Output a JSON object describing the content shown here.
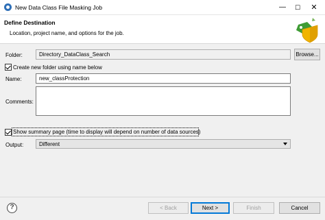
{
  "window": {
    "title": "New Data Class File Masking Job",
    "icon": "masking-app-icon",
    "minimize_glyph": "—",
    "maximize_glyph": "☐",
    "close_glyph": "✕"
  },
  "header": {
    "title": "Define Destination",
    "description": "Location, project name, and options for the job.",
    "art_icon": "tag-shield-icon"
  },
  "form": {
    "folder_label": "Folder:",
    "folder_value": "Directory_DataClass_Search",
    "browse_label": "Browse...",
    "create_folder_label": "Create new folder using name below",
    "create_folder_checked": true,
    "name_label": "Name:",
    "name_value": "new_classProtection",
    "comments_label": "Comments:",
    "comments_value": "",
    "summary_label": "Show summary page (time to display will depend on number of data sources)",
    "summary_checked": true,
    "output_label": "Output:",
    "output_value": "Different"
  },
  "footer": {
    "help_glyph": "?",
    "back_label": "< Back",
    "next_label": "Next >",
    "finish_label": "Finish",
    "cancel_label": "Cancel"
  },
  "colors": {
    "accent": "#0078d7",
    "tag_green": "#3f9c35",
    "shield_yellow": "#f0b400"
  }
}
